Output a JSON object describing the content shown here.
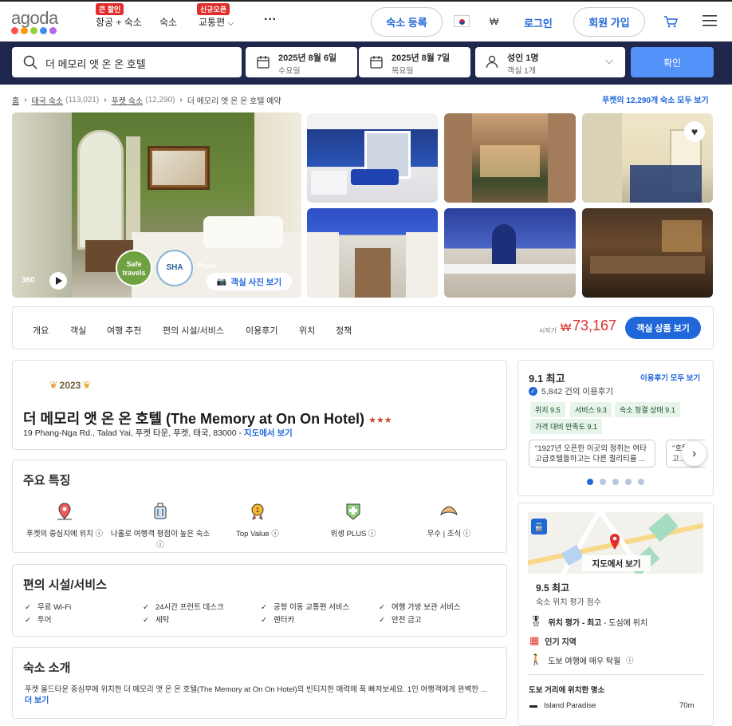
{
  "header": {
    "logo": "agoda",
    "logo_dot_colors": [
      "#ff4f4f",
      "#ff9a00",
      "#8fd13f",
      "#3e8ef7",
      "#b36bea"
    ],
    "nav": [
      {
        "label": "항공 + 숙소",
        "badge": "큰 할인"
      },
      {
        "label": "숙소"
      },
      {
        "label": "교통편",
        "badge": "신규오픈"
      },
      {
        "label": "···"
      }
    ],
    "list_property": "숙소 등록",
    "currency": "₩",
    "login": "로그인",
    "signup": "회원 가입"
  },
  "search": {
    "query": "더 메모리 앳 온 온 호텔",
    "checkin_date": "2025년 8월 6일",
    "checkin_day": "수요일",
    "checkout_date": "2025년 8월 7일",
    "checkout_day": "목요일",
    "guests": "성인 1명",
    "rooms": "객실 1개",
    "submit": "확인"
  },
  "breadcrumb": {
    "home": "홈",
    "country": "태국 숙소",
    "country_count": "(113,021)",
    "city": "푸켓 숙소",
    "city_count": "(12,290)",
    "current": "더 메모리 앳 온 온 호텔 예약",
    "see_all": "푸켓의 12,290개 숙소 모두 보기"
  },
  "gallery": {
    "badge_360": "360",
    "safe_travels": "Safe travels",
    "sha": "SHA",
    "sha_plus": "Plus+",
    "room_photos": "객실 사진 보기"
  },
  "tabs": [
    "개요",
    "객실",
    "여행 추천",
    "편의 시설/서비스",
    "이용후기",
    "위치",
    "정책"
  ],
  "price": {
    "prefix": "시작가",
    "currency": "₩",
    "amount": "73,167",
    "cta": "객실 상품 보기"
  },
  "hotel": {
    "award_year": "2023",
    "name": "더 메모리 앳 온 온 호텔 (The Memory at On On Hotel)",
    "stars": "★★★",
    "address": "19 Phang-Nga Rd., Talad Yai, 푸켓 타운, 푸켓, 태국, 83000",
    "map_link": "지도에서 보기"
  },
  "features": {
    "title": "주요 특징",
    "items": [
      {
        "label": "푸켓의 중심지에 위치",
        "icon": "map-pin-icon"
      },
      {
        "label": "나홀로 여행객 평점이 높은 숙소",
        "icon": "luggage-icon"
      },
      {
        "label": "Top Value",
        "icon": "medal-icon"
      },
      {
        "label": "위생 PLUS",
        "icon": "hygiene-plus-icon"
      },
      {
        "label": "우수 | 조식",
        "icon": "croissant-icon"
      }
    ]
  },
  "facilities": {
    "title": "편의 시설/서비스",
    "items": [
      "무료 Wi-Fi",
      "24시간 프런트 데스크",
      "공항 이동 교통편 서비스",
      "여행 가방 보관 서비스",
      "투어",
      "세탁",
      "렌터카",
      "안전 금고"
    ]
  },
  "about": {
    "title": "숙소 소개",
    "text": "푸켓 올드타운 중심부에 위치한 더 메모리 앳 온 온 호텔(The Memory at On On Hotel)의 빈티지한 매력에 푹 빠져보세요. 1인 여행객에게 완벽한 ...",
    "more": "더 보기"
  },
  "reviews": {
    "score": "9.1 최고",
    "count": "5,842 건의 이용후기",
    "all_link": "이용후기 모두 보기",
    "chips": [
      "위치 9.5",
      "서비스 9.3",
      "숙소 청결 상태 9.1",
      "가격 대비 만족도 9.1"
    ],
    "quotes": [
      "\"1927년 오픈한 이곳의 정취는 여타 고급호텔들하고는 다른 퀄리티를 ...",
      "\"호텔 하고..."
    ]
  },
  "location": {
    "map_label": "지도에서 보기",
    "score": "9.5 최고",
    "score_label": "숙소 위치 평가 점수",
    "rating_bold": "위치 평가 - 최고",
    "rating_rest": " - 도심에 위치",
    "popular": "인기 지역",
    "walk": "도보 여행에 매우 탁월",
    "nearby_title": "도보 거리에 위치한 명소",
    "nearby": [
      {
        "name": "Island Paradise",
        "distance": "70m"
      }
    ]
  },
  "colors": {
    "brand_blue": "#2067da",
    "navy": "#20274d",
    "price_red": "#e12d2d"
  }
}
